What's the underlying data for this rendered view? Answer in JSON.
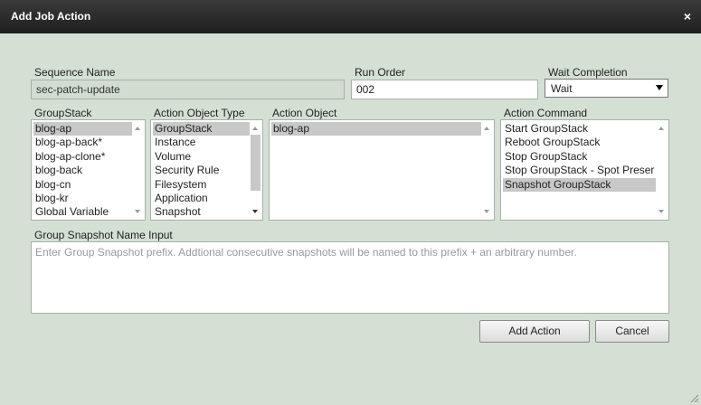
{
  "dialog": {
    "title": "Add Job Action",
    "close_symbol": "×"
  },
  "sequence_name": {
    "label": "Sequence Name",
    "value": "sec-patch-update"
  },
  "run_order": {
    "label": "Run Order",
    "value": "002"
  },
  "wait_completion": {
    "label": "Wait Completion",
    "value": "Wait"
  },
  "groupstack": {
    "label": "GroupStack",
    "items": [
      "blog-ap",
      "blog-ap-back*",
      "blog-ap-clone*",
      "blog-back",
      "blog-cn",
      "blog-kr",
      "Global Variable"
    ]
  },
  "action_object_type": {
    "label": "Action Object Type",
    "items": [
      "GroupStack",
      "Instance",
      "Volume",
      "Security Rule",
      "Filesystem",
      "Application",
      "Snapshot"
    ]
  },
  "action_object": {
    "label": "Action Object",
    "items": [
      "blog-ap"
    ]
  },
  "action_command": {
    "label": "Action Command",
    "items": [
      "Start GroupStack",
      "Reboot GroupStack",
      "Stop GroupStack",
      "Stop GroupStack - Spot Preser",
      "Snapshot GroupStack"
    ]
  },
  "snapshot_name": {
    "label": "Group Snapshot Name Input",
    "placeholder": "Enter Group Snapshot prefix. Addtional consecutive snapshots will be named to this prefix + an arbitrary number."
  },
  "buttons": {
    "add_action": "Add Action",
    "cancel": "Cancel"
  }
}
